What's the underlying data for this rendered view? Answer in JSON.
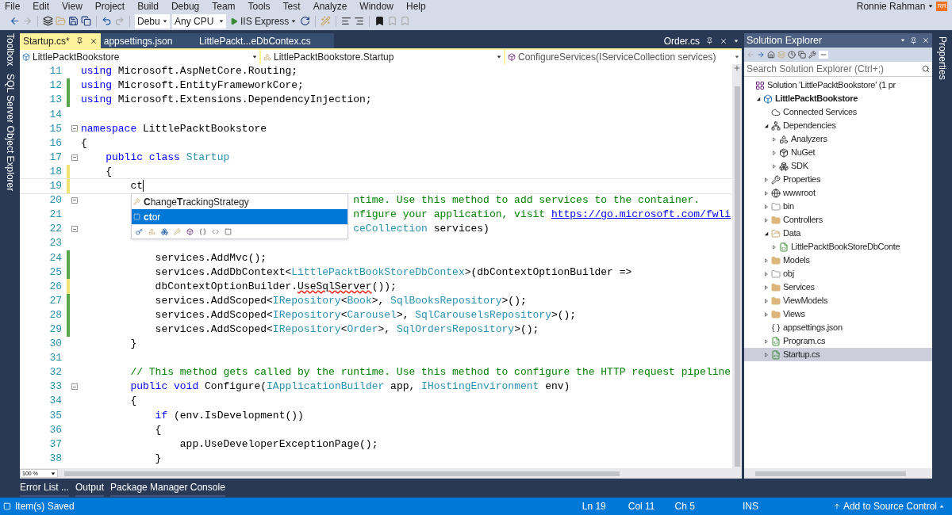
{
  "menu": [
    "File",
    "Edit",
    "View",
    "Project",
    "Build",
    "Debug",
    "Team",
    "Tools",
    "Test",
    "Analyze",
    "Window",
    "Help"
  ],
  "user": {
    "name": "Ronnie Rahman",
    "initials": "RR"
  },
  "toolbar": {
    "configuration": "Debu",
    "platform": "Any CPU",
    "run_target": "IIS Express"
  },
  "side_left": [
    "Toolbox",
    "SQL Server Object Explorer"
  ],
  "side_right": [
    "Properties"
  ],
  "tabs": [
    {
      "label": "Startup.cs*",
      "selected": true
    },
    {
      "label": "appsettings.json",
      "selected": false
    },
    {
      "label": "LittlePackt...eDbContex.cs",
      "selected": false
    }
  ],
  "preview_tab": {
    "label": "Order.cs"
  },
  "nav": {
    "project": "LittlePacktBookstore",
    "type": "LittlePacktBookstore.Startup",
    "member": "ConfigureServices(IServiceCollection services)"
  },
  "editor": {
    "zoom": "100 %",
    "lines": [
      {
        "number": "11",
        "modified": false,
        "fold": false,
        "caret": false,
        "segments": [
          {
            "kind": "keyword",
            "text": "using"
          },
          {
            "kind": "plain",
            "text": " Microsoft.AspNetCore.Routing;"
          }
        ]
      },
      {
        "number": "12",
        "modified": true,
        "saved": true,
        "fold": false,
        "caret": false,
        "segments": [
          {
            "kind": "keyword",
            "text": "using"
          },
          {
            "kind": "plain",
            "text": " Microsoft.EntityFrameworkCore;"
          }
        ]
      },
      {
        "number": "13",
        "modified": true,
        "saved": true,
        "fold": false,
        "caret": false,
        "segments": [
          {
            "kind": "keyword",
            "text": "using"
          },
          {
            "kind": "plain",
            "text": " Microsoft.Extensions.DependencyInjection;"
          }
        ]
      },
      {
        "number": "14",
        "modified": false,
        "fold": false,
        "caret": false
      },
      {
        "number": "15",
        "modified": false,
        "fold": true,
        "caret": false,
        "segments": [
          {
            "kind": "keyword",
            "text": "namespace"
          },
          {
            "kind": "plain",
            "text": " LittlePacktBookstore"
          }
        ]
      },
      {
        "number": "16",
        "modified": false,
        "fold": false,
        "caret": false,
        "segments": [
          {
            "kind": "plain",
            "text": "{"
          }
        ]
      },
      {
        "number": "17",
        "modified": false,
        "fold": true,
        "caret": false,
        "segments": [
          {
            "kind": "keyword",
            "text": "    public class"
          },
          {
            "kind": "type",
            "text": " Startup"
          }
        ]
      },
      {
        "number": "18",
        "modified": true,
        "saved": false,
        "fold": false,
        "caret": false,
        "segments": [
          {
            "kind": "plain",
            "text": "    {"
          }
        ]
      },
      {
        "number": "19",
        "modified": true,
        "saved": false,
        "fold": false,
        "caret": true,
        "segments": [
          {
            "kind": "plain",
            "text": "        ct"
          }
        ]
      },
      {
        "number": "20",
        "modified": false,
        "fold": true,
        "caret": false,
        "segments": [
          {
            "kind": "comment",
            "text": "                                            ntime. Use this method to add services to the container."
          }
        ]
      },
      {
        "number": "21",
        "modified": false,
        "fold": false,
        "caret": false,
        "segments": [
          {
            "kind": "comment",
            "text": "                                            nfigure your application, visit "
          },
          {
            "kind": "link",
            "text": "https://go.microsoft.com/fwli"
          }
        ]
      },
      {
        "number": "22",
        "modified": false,
        "fold": true,
        "caret": false,
        "segments": [
          {
            "kind": "type",
            "text": "                                            ceCollection"
          },
          {
            "kind": "plain",
            "text": " services)"
          }
        ]
      },
      {
        "number": "23",
        "modified": false,
        "fold": false,
        "caret": false
      },
      {
        "number": "24",
        "modified": true,
        "saved": true,
        "fold": false,
        "caret": false,
        "segments": [
          {
            "kind": "plain",
            "text": "            services.AddMvc();"
          }
        ]
      },
      {
        "number": "25",
        "modified": true,
        "saved": true,
        "fold": false,
        "caret": false,
        "segments": [
          {
            "kind": "plain",
            "text": "            services.AddDbContext<"
          },
          {
            "kind": "type",
            "text": "LittlePacktBookStoreDbContex"
          },
          {
            "kind": "plain",
            "text": ">(dbContextOptionBuilder =>"
          }
        ]
      },
      {
        "number": "26",
        "modified": true,
        "saved": false,
        "fold": false,
        "caret": false,
        "segments": [
          {
            "kind": "plain",
            "text": "            dbContextOptionBuilder."
          },
          {
            "kind": "error",
            "text": "UseSqlServer"
          },
          {
            "kind": "plain",
            "text": "());"
          }
        ]
      },
      {
        "number": "27",
        "modified": true,
        "saved": true,
        "fold": false,
        "caret": false,
        "segments": [
          {
            "kind": "plain",
            "text": "            services.AddScoped<"
          },
          {
            "kind": "type",
            "text": "IRepository"
          },
          {
            "kind": "plain",
            "text": "<"
          },
          {
            "kind": "type",
            "text": "Book"
          },
          {
            "kind": "plain",
            "text": ">, "
          },
          {
            "kind": "type",
            "text": "SqlBooksRepository"
          },
          {
            "kind": "plain",
            "text": ">();"
          }
        ]
      },
      {
        "number": "28",
        "modified": true,
        "saved": true,
        "fold": false,
        "caret": false,
        "segments": [
          {
            "kind": "plain",
            "text": "            services.AddScoped<"
          },
          {
            "kind": "type",
            "text": "IRepository"
          },
          {
            "kind": "plain",
            "text": "<"
          },
          {
            "kind": "type",
            "text": "Carousel"
          },
          {
            "kind": "plain",
            "text": ">, "
          },
          {
            "kind": "type",
            "text": "SqlCarouselsRepository"
          },
          {
            "kind": "plain",
            "text": ">();"
          }
        ]
      },
      {
        "number": "29",
        "modified": true,
        "saved": true,
        "fold": false,
        "caret": false,
        "segments": [
          {
            "kind": "plain",
            "text": "            services.AddScoped<"
          },
          {
            "kind": "type",
            "text": "IRepository"
          },
          {
            "kind": "plain",
            "text": "<"
          },
          {
            "kind": "type",
            "text": "Order"
          },
          {
            "kind": "plain",
            "text": ">, "
          },
          {
            "kind": "type",
            "text": "SqlOrdersRepository"
          },
          {
            "kind": "plain",
            "text": ">();"
          }
        ]
      },
      {
        "number": "30",
        "modified": false,
        "fold": false,
        "caret": false,
        "segments": [
          {
            "kind": "plain",
            "text": "        }"
          }
        ]
      },
      {
        "number": "31",
        "modified": false,
        "fold": false,
        "caret": false
      },
      {
        "number": "32",
        "modified": false,
        "fold": false,
        "caret": false,
        "segments": [
          {
            "kind": "comment",
            "text": "        // This method gets called by the runtime. Use this method to configure the HTTP request pipeline"
          }
        ]
      },
      {
        "number": "33",
        "modified": false,
        "fold": true,
        "caret": false,
        "segments": [
          {
            "kind": "keyword",
            "text": "        public void"
          },
          {
            "kind": "plain",
            "text": " Configure("
          },
          {
            "kind": "type",
            "text": "IApplicationBuilder"
          },
          {
            "kind": "plain",
            "text": " app, "
          },
          {
            "kind": "type",
            "text": "IHostingEnvironment"
          },
          {
            "kind": "plain",
            "text": " env)"
          }
        ]
      },
      {
        "number": "34",
        "modified": false,
        "fold": false,
        "caret": false,
        "segments": [
          {
            "kind": "plain",
            "text": "        {"
          }
        ]
      },
      {
        "number": "35",
        "modified": false,
        "fold": false,
        "caret": false,
        "segments": [
          {
            "kind": "keyword",
            "text": "            if"
          },
          {
            "kind": "plain",
            "text": " (env.IsDevelopment())"
          }
        ]
      },
      {
        "number": "36",
        "modified": false,
        "fold": false,
        "caret": false,
        "segments": [
          {
            "kind": "plain",
            "text": "            {"
          }
        ]
      },
      {
        "number": "37",
        "modified": false,
        "fold": false,
        "caret": false,
        "segments": [
          {
            "kind": "plain",
            "text": "                app.UseDeveloperExceptionPage();"
          }
        ]
      },
      {
        "number": "38",
        "modified": false,
        "fold": false,
        "caret": false,
        "segments": [
          {
            "kind": "plain",
            "text": "            }"
          }
        ]
      }
    ]
  },
  "completion": {
    "items": [
      {
        "label": "**C**hange**T**rackingStrategy",
        "kind": "property",
        "selected": false
      },
      {
        "label": "**ct**or",
        "kind": "snippet",
        "selected": true
      }
    ]
  },
  "solution_explorer": {
    "title": "Solution Explorer",
    "search": {
      "placeholder": "Search Solution Explorer (Ctrl+;)"
    },
    "tree": [
      {
        "label": "Solution 'LittlePacktBookstore' (1 pr",
        "kind": "solution",
        "selected": false,
        "children": [
          {
            "label": "LittlePacktBookstore",
            "kind": "project",
            "expanded": true,
            "selected": false,
            "children": [
              {
                "label": "Connected Services",
                "kind": "service",
                "selected": false
              },
              {
                "label": "Dependencies",
                "kind": "dependencies",
                "expanded": true,
                "selected": false,
                "children": [
                  {
                    "label": "Analyzers",
                    "kind": "analyzer",
                    "expanded": false,
                    "selected": false
                  },
                  {
                    "label": "NuGet",
                    "kind": "package",
                    "expanded": false,
                    "selected": false
                  },
                  {
                    "label": "SDK",
                    "kind": "sdk",
                    "expanded": false,
                    "selected": false
                  }
                ]
              },
              {
                "label": "Properties",
                "kind": "properties",
                "expanded": false,
                "selected": false
              },
              {
                "label": "wwwroot",
                "kind": "web",
                "expanded": false,
                "selected": false
              },
              {
                "label": "bin",
                "kind": "hidden-folder",
                "expanded": false,
                "selected": false
              },
              {
                "label": "Controllers",
                "kind": "folder",
                "expanded": false,
                "selected": false
              },
              {
                "label": "Data",
                "kind": "open-folder",
                "expanded": true,
                "selected": false,
                "children": [
                  {
                    "label": "LittlePacktBookStoreDbConte",
                    "kind": "csharp",
                    "expanded": false,
                    "selected": false
                  }
                ]
              },
              {
                "label": "Models",
                "kind": "folder",
                "expanded": false,
                "selected": false
              },
              {
                "label": "obj",
                "kind": "hidden-folder",
                "expanded": false,
                "selected": false
              },
              {
                "label": "Services",
                "kind": "folder",
                "expanded": false,
                "selected": false
              },
              {
                "label": "ViewModels",
                "kind": "folder",
                "expanded": false,
                "selected": false
              },
              {
                "label": "Views",
                "kind": "folder",
                "expanded": false,
                "selected": false
              },
              {
                "label": "appsettings.json",
                "kind": "json",
                "selected": false
              },
              {
                "label": "Program.cs",
                "kind": "csharp",
                "expanded": false,
                "selected": false
              },
              {
                "label": "Startup.cs",
                "kind": "csharp",
                "expanded": false,
                "selected": true
              }
            ]
          }
        ]
      }
    ]
  },
  "tool_tabs": [
    "Error List ...",
    "Output",
    "Package Manager Console"
  ],
  "status_bar": {
    "message": "Item(s) Saved",
    "line": "Ln 19",
    "column": "Col 11",
    "char": "Ch 5",
    "mode": "INS",
    "source_control": "Add to Source Control"
  }
}
